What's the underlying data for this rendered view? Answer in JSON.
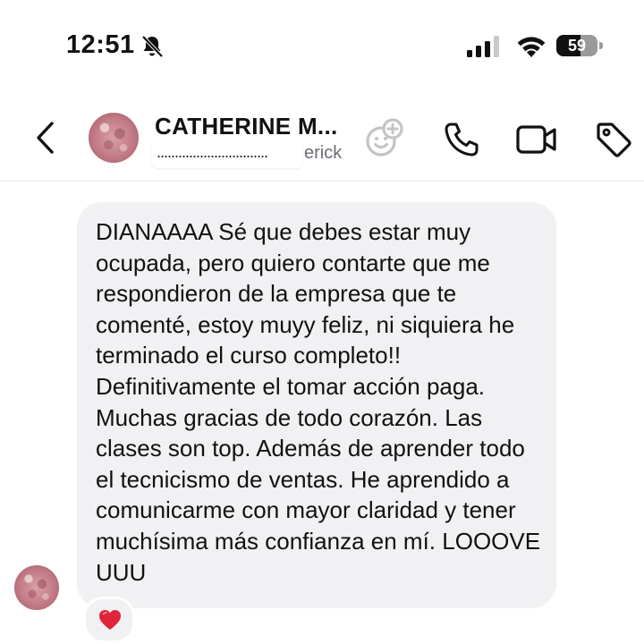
{
  "status": {
    "time": "12:51",
    "battery_level": "59",
    "battery_fraction": 0.59
  },
  "header": {
    "contact_name": "CATHERINE M...",
    "subtitle_masked": "...............................",
    "subtitle_suffix": "erick"
  },
  "message": {
    "text": "DIANAAAA Sé que debes estar muy ocupada, pero quiero contarte que me respondieron de la empresa que te comenté, estoy muyy feliz, ni siquiera he terminado el curso completo!! Definitivamente el tomar acción paga. Muchas gracias de todo corazón. Las clases son top. Además de aprender todo el tecnicismo de ventas. He aprendido a comunicarme con mayor claridad y tener muchísima más confianza en mí. LOOOVE UUU",
    "reaction": "heart-icon"
  },
  "icons": {
    "status": [
      "bell-slash-icon",
      "cellular-signal-icon",
      "wifi-icon",
      "battery-icon"
    ],
    "header": [
      "back-chevron-icon",
      "add-reaction-icon",
      "phone-icon",
      "video-camera-icon",
      "tag-icon"
    ]
  },
  "colors": {
    "bubble": "#f1f1f4",
    "heart": "#e0243a",
    "subtitle": "#6b6e74"
  }
}
